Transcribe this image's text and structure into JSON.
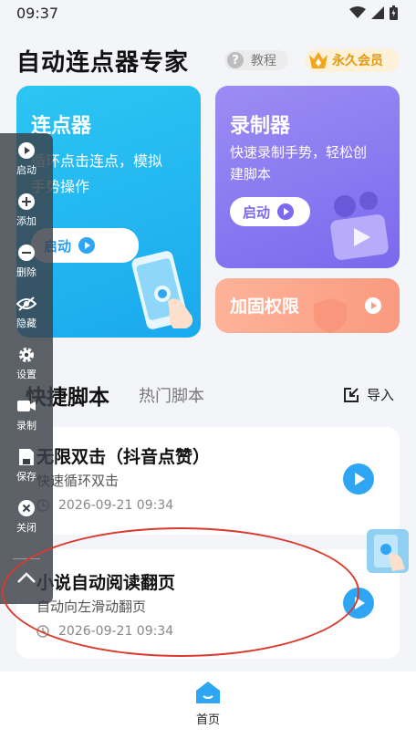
{
  "status_bar": {
    "time": "09:37"
  },
  "header": {
    "title": "自动连点器专家",
    "tutorial_label": "教程",
    "vip_label": "永久会员"
  },
  "clicker_card": {
    "title": "连点器",
    "desc_line1": "循环点击连点，模拟",
    "desc_line2": "手势操作",
    "start_label": "启动"
  },
  "recorder_card": {
    "title": "录制器",
    "desc_line1": "快速录制手势，轻松创",
    "desc_line2": "建脚本",
    "start_label": "启动"
  },
  "permission_card": {
    "title": "加固权限"
  },
  "tabs": {
    "active": "快捷脚本",
    "inactive": "热门脚本",
    "import_label": "导入"
  },
  "scripts": [
    {
      "title": "无限双击（抖音点赞）",
      "desc": "快速循环双击",
      "time": "2026-09-21 09:34"
    },
    {
      "title": "小说自动阅读翻页",
      "desc": "自动向左滑动翻页",
      "time": "2026-09-21 09:34"
    }
  ],
  "toolbar": {
    "start": "启动",
    "add": "添加",
    "delete": "删除",
    "hide": "隐藏",
    "settings": "设置",
    "record": "录制",
    "save": "保存",
    "close": "关闭"
  },
  "bottom_nav": {
    "home_label": "首页"
  },
  "colors": {
    "accent_blue": "#2ea6f4",
    "recorder_purple": "#7b69ee",
    "permission_orange": "#fa9a7f",
    "vip_gold": "#e39a12",
    "annotation_red": "#d93a2e"
  }
}
